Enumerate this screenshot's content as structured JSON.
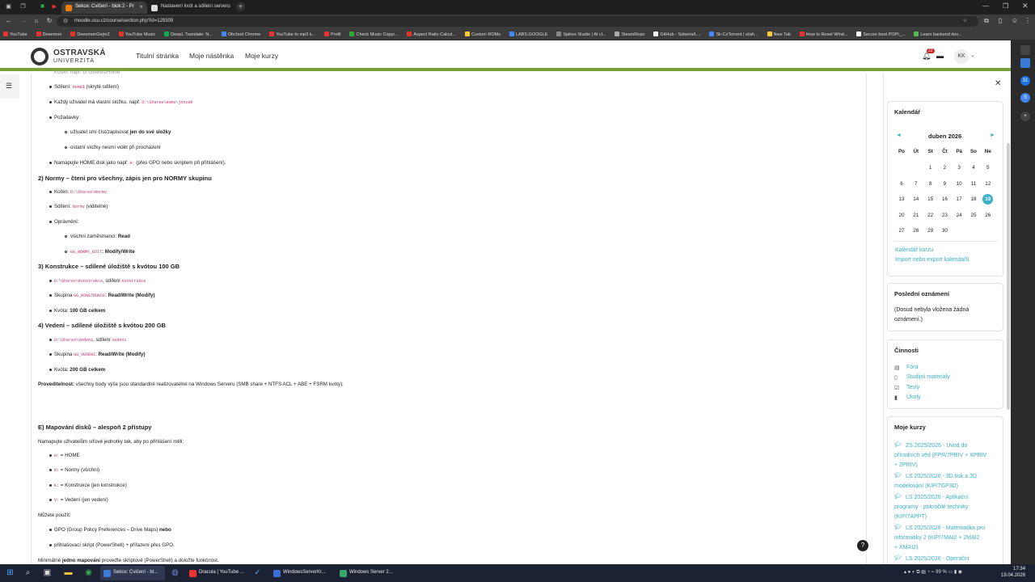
{
  "browser": {
    "tabs": [
      {
        "label": "Sekce: Cvičení - blok 2 - Pr",
        "active": true
      },
      {
        "label": "Nastavení kvót a sdílení serveru",
        "active": false
      }
    ],
    "url": "moodle.osu.cz/course/section.php?id=129309",
    "bookmarks": [
      "YouTube",
      "Deeemon",
      "DeeemonGejmZ",
      "YouTube Music",
      "DeepL Translate: N...",
      "Obchod Chrome",
      "YouTube to mp3 k...",
      "Profil",
      "Check Music Copyr...",
      "Aspect Ratio Calcul...",
      "Custom ROMs",
      "LABS.GOOGLE",
      "Spikes Studio | AI cl...",
      "SteamRepo",
      "GitHub - Soberia/L...",
      "Sk-CzTorrent | sťah...",
      "New Tab",
      "How to Reset Wind...",
      "Secure boot POPI_...",
      "Learn backend dev..."
    ]
  },
  "site": {
    "logo_line1": "OSTRAVSKÁ",
    "logo_line2": "UNIVERZITA",
    "nav": [
      "Titulní stránka",
      "Moje nástěnka",
      "Moje kurzy"
    ],
    "notification_count": "22",
    "avatar": "KK"
  },
  "content": {
    "l_top": "Kořen: např. D:\\Shares\\Home",
    "l1a": "Sdílení: ",
    "l1b": "Home$",
    "l1c": " (skryté sdílení)",
    "l2a": "Každý uživatel má vlastní složku, např. ",
    "l2b": "D:\\Shares\\Home\\jnovak",
    "l3": "Požadavky:",
    "l4a": "uživatel smí číst/zapisovat ",
    "l4b": "jen do své složky",
    "l5": "ostatní složky nesmí vidět při procházení",
    "l6a": "Namapujte HOME disk jako např. ",
    "l6b": "H:",
    "l6c": " (přes GPO nebo skriptem při přihlášení).",
    "h2": "2) Normy – čtení pro všechny, zápis jen pro NORMY skupinu",
    "n1a": "Kořen: ",
    "n1b": "D:\\Shares\\Normy",
    "n2a": "Sdílení: ",
    "n2b": "Normy",
    "n2c": " (viditelné)",
    "n3": "Oprávnění:",
    "n4a": "všichni zaměstnanci: ",
    "n4b": "Read",
    "n5a": "GG_NORMY_EDIT",
    "n5b": ": Modify/Write",
    "h3": "3) Konstrukce – sdílené úložiště s kvótou 100 GB",
    "k1a": "D:\\Shares\\Konstrukce",
    "k1b": ", sdílení ",
    "k1c": "Konstrukce",
    "k2a": "Skupina ",
    "k2b": "GG_KONSTRUKCE",
    "k2c": ": ",
    "k2d": "Read/Write (Modify)",
    "k3a": "Kvóta: ",
    "k3b": "100 GB celkem",
    "h4": "4) Vedení – sdílené úložiště s kvótou 200 GB",
    "v1a": "D:\\Shares\\Vedeni",
    "v1b": ", sdílení ",
    "v1c": "Vedeni",
    "v2a": "Skupina ",
    "v2b": "GG_VEDENI",
    "v2c": ": ",
    "v2d": "Read/Write (Modify)",
    "v3a": "Kvóta: ",
    "v3b": "200 GB celkem",
    "p1a": "Proveditelnost:",
    "p1b": " všechny body výše jsou standardně realizovatelné na Windows Serveru (SMB share + NTFS ACL + ABE + FSRM kvóty).",
    "h5": "E) Mapování disků – alespoň 2 přístupy",
    "e1": "Namapujte uživatelům síťové jednotky tak, aby po přihlášení měli:",
    "m1a": "H:",
    "m1b": " = HOME",
    "m2a": "N:",
    "m2b": " = Normy (všichni)",
    "m3a": "K:",
    "m3b": " = Konstrukce (jen konstrukce)",
    "m4a": "V:",
    "m4b": " = Vedení (jen vedení)",
    "e2": "Můžete použít:",
    "u1a": "GPO (Group Policy Preferences – Drive Maps) ",
    "u1b": "nebo",
    "u2": "přihlašovací skript (PowerShell) + přiřazení přes GPO.",
    "e3a": "Minimálně ",
    "e3b": "jedno mapování",
    "e3c": " proveďte skriptově (PowerShell) a doložte funkčnost."
  },
  "calendar": {
    "title": "Kalendář",
    "month": "duben 2026",
    "weekdays": [
      "Po",
      "Út",
      "St",
      "Čt",
      "Pá",
      "So",
      "Ne"
    ],
    "rows": [
      [
        "",
        "",
        "1",
        "2",
        "3",
        "4",
        "5"
      ],
      [
        "6",
        "7",
        "8",
        "9",
        "10",
        "11",
        "12"
      ],
      [
        "13",
        "14",
        "15",
        "16",
        "17",
        "18",
        "19"
      ],
      [
        "20",
        "21",
        "22",
        "23",
        "24",
        "25",
        "26"
      ],
      [
        "27",
        "28",
        "29",
        "30",
        "",
        "",
        ""
      ]
    ],
    "today": "19",
    "link1": "Kalendář kurzu",
    "link2": "Import nebo export kalendářů"
  },
  "announcements": {
    "title": "Poslední oznámení",
    "text1": "(Dosud nebyla vložena žádná",
    "text2": "oznámení.)"
  },
  "activities": {
    "title": "Činnosti",
    "items": [
      "Fóra",
      "Studijní materiály",
      "Testy",
      "Úkoly"
    ]
  },
  "mycourses": {
    "title": "Moje kurzy",
    "c1": [
      "ZS 2025/2026 - Úvod do",
      "přírodních věd (FPR/7PRIV + XPRIV",
      "+ 2PRIV)"
    ],
    "c2": [
      "LS 2025/2026 - 3D tisk a 3D",
      "modelování (KIP/7GP3D)"
    ],
    "c3": [
      "LS 2025/2026 - Aplikační",
      "programy - pokročilé techniky",
      "(KIP/7APPT)"
    ],
    "c4": [
      "LS 2025/2026 - Matematika pro",
      "informatiky 2 (KIP/7MAI2 + 2MAI2",
      "+ XMAI2)"
    ],
    "c5": [
      "LS 2025/2026 - Operační"
    ]
  },
  "taskbar": {
    "apps": [
      "Sekce: Cvičení - bl...",
      "Dracula | YouTube ...",
      "WindowsServerKr...",
      "Windows Server 2..."
    ],
    "battery": "99 %",
    "time": "17:34",
    "date": "19.04.2026"
  },
  "colors": {
    "accent": "#3bb0c9",
    "navbar_border": "#7aa03a",
    "code": "#c0306a"
  }
}
